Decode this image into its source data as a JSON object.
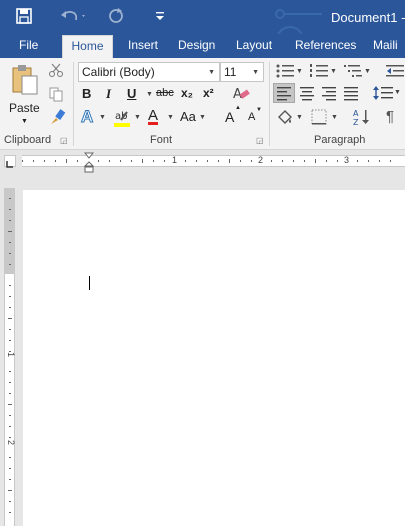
{
  "title_bar": {
    "document_title": "Document1 - "
  },
  "tabs": [
    "File",
    "Home",
    "Insert",
    "Design",
    "Layout",
    "References",
    "Maili"
  ],
  "clipboard": {
    "paste_label": "Paste",
    "group_label": "Clipboard"
  },
  "font": {
    "font_name": "Calibri (Body)",
    "font_size": "11",
    "bold": "B",
    "italic": "I",
    "underline": "U",
    "strike": "abc",
    "subscript": "x₂",
    "superscript": "x²",
    "text_effects": "A",
    "font_color": "A",
    "change_case": "Aa",
    "grow_font": "A",
    "shrink_font": "A",
    "group_label": "Font"
  },
  "paragraph": {
    "pilcrow": "¶",
    "group_label": "Paragraph"
  },
  "ruler": {
    "numbers": [
      "1",
      "2",
      "3"
    ]
  },
  "vruler": {
    "numbers": [
      "1",
      "2"
    ]
  },
  "colors": {
    "accent": "#2b579a",
    "highlight": "#ffff00",
    "font_color": "#e51e1e"
  },
  "icons": [
    "save-icon",
    "undo-icon",
    "redo-icon",
    "customize-qat-icon"
  ]
}
